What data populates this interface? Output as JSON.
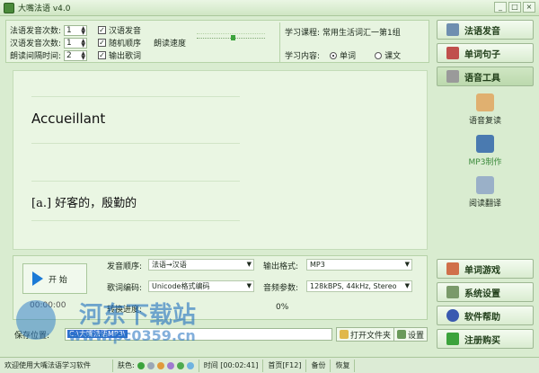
{
  "window": {
    "title": "大嘴法语 v4.0",
    "min": "_",
    "max": "□",
    "close": "×"
  },
  "settings": {
    "fr_count_label": "法语发音次数:",
    "fr_count": "1",
    "cn_count_label": "汉语发音次数:",
    "cn_count": "1",
    "interval_label": "朗读间隔时间:",
    "interval": "2",
    "chk_cn": "汉语发音",
    "chk_random": "随机顺序",
    "chk_output": "输出歌词",
    "speed_label": "朗读速度",
    "speed_level": 0.53,
    "course_label": "学习课程:",
    "course_value": "常用生活词汇一第1组",
    "content_label": "学习内容:",
    "opt_word": "单词",
    "opt_text": "课文",
    "selected_content": "单词"
  },
  "display": {
    "word": "Accueillant",
    "meaning": "[a.] 好客的，殷勤的"
  },
  "controls": {
    "play_label": "开 始",
    "time": "00:00:00",
    "order_label": "发音顺序:",
    "order_value": "法语→汉语",
    "format_label": "输出格式:",
    "format_value": "MP3",
    "encoding_label": "歌词编码:",
    "encoding_value": "Unicode格式编码",
    "audio_label": "音频参数:",
    "audio_value": "128kBPS, 44kHz, Stereo",
    "progress_label": "转换进度:",
    "progress_value": "0%"
  },
  "pathbar": {
    "label": "保存位置:",
    "path": "C:\\大嘴法语MP3\\",
    "open_folder": "打开文件夹",
    "settings": "设置"
  },
  "rightbar": {
    "btn_pronunciation": "法语发音",
    "btn_sentence": "单词句子",
    "btn_tools": "语音工具",
    "tool_review": "语音复读",
    "tool_mp3": "MP3制作",
    "tool_translate": "阅读翻译",
    "btn_game": "单词游戏",
    "btn_settings": "系统设置",
    "btn_help": "软件帮助",
    "btn_register": "注册购买"
  },
  "statusbar": {
    "welcome": "欢迎使用大嘴法语学习软件",
    "skin_label": "肤色:",
    "skin_colors": [
      "#3ca33c",
      "#9aa7b5",
      "#e09a3c",
      "#a07ad0",
      "#4faa4f",
      "#6fb3e0"
    ],
    "time": "时间 [00:02:41]",
    "home": "首页[F12]",
    "backup": "备份",
    "restore": "恢复"
  },
  "watermark": {
    "text": "河东下载站",
    "url": "www.pc0359.cn"
  }
}
